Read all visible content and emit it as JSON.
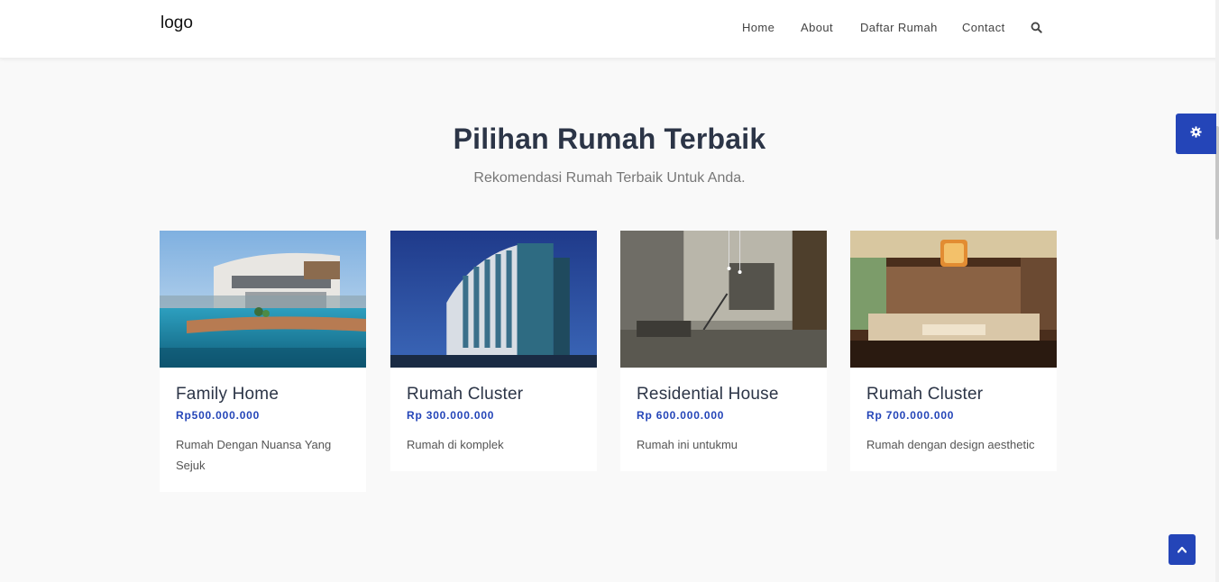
{
  "header": {
    "logo": "logo",
    "nav": [
      {
        "label": "Home"
      },
      {
        "label": "About"
      },
      {
        "label": "Daftar Rumah"
      },
      {
        "label": "Contact"
      }
    ],
    "search_icon": "search-icon"
  },
  "section": {
    "title": "Pilihan Rumah Terbaik",
    "subtitle": "Rekomendasi Rumah Terbaik Untuk Anda."
  },
  "cards": [
    {
      "name": "Family Home",
      "price": "Rp500.000.000",
      "desc": "Rumah Dengan Nuansa Yang Sejuk",
      "image": "modern villa with swimming pool"
    },
    {
      "name": "Rumah Cluster",
      "price": "Rp 300.000.000",
      "desc": "Rumah di komplek",
      "image": "curved glass building at dusk"
    },
    {
      "name": "Residential House",
      "price": "Rp 600.000.000",
      "desc": "Rumah ini untukmu",
      "image": "loft interior with staircase"
    },
    {
      "name": "Rumah Cluster",
      "price": "Rp 700.000.000",
      "desc": "Rumah dengan design aesthetic",
      "image": "luxury living room with chandelier"
    }
  ],
  "widgets": {
    "settings_icon": "gear-icon",
    "back_to_top_icon": "chevron-up-icon"
  },
  "colors": {
    "accent": "#2445b8",
    "heading": "#2c3547",
    "background": "#f9f9f9"
  }
}
